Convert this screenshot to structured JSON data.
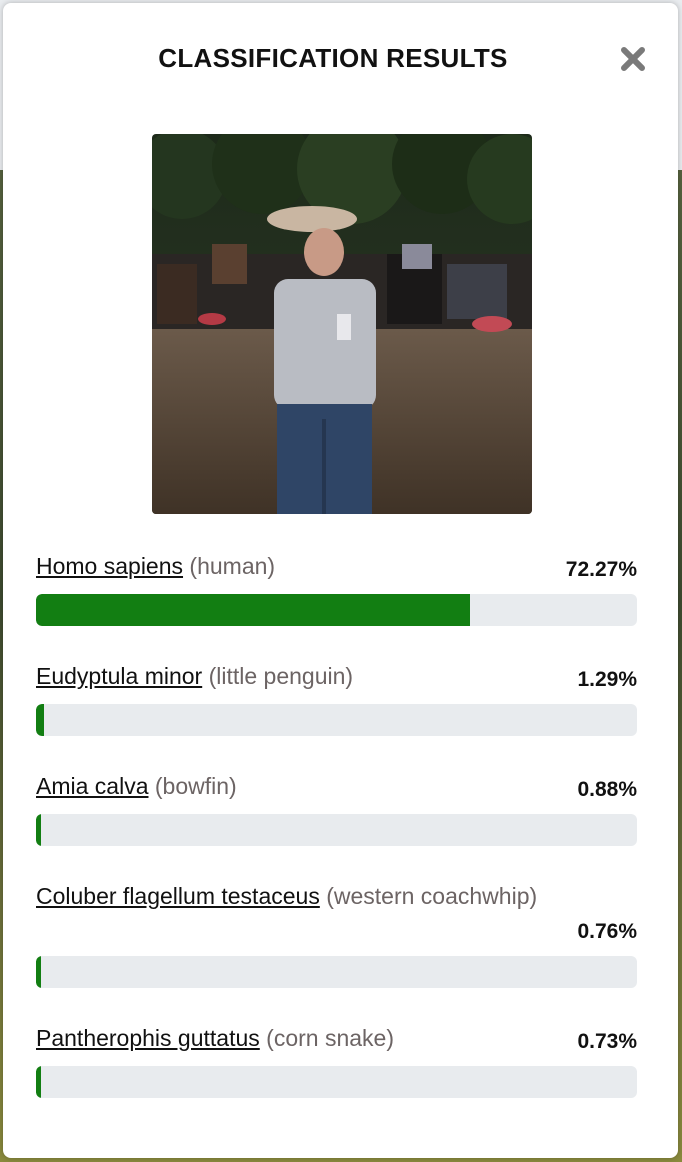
{
  "modal": {
    "title": "CLASSIFICATION RESULTS",
    "close_icon": "close-icon"
  },
  "results": [
    {
      "scientific": "Homo sapiens",
      "common": "(human)",
      "percent_label": "72.27%",
      "percent": 72.27
    },
    {
      "scientific": "Eudyptula minor",
      "common": "(little penguin)",
      "percent_label": "1.29%",
      "percent": 1.29
    },
    {
      "scientific": "Amia calva",
      "common": "(bowfin)",
      "percent_label": "0.88%",
      "percent": 0.88
    },
    {
      "scientific": "Coluber flagellum testaceus",
      "common": "(western coachwhip)",
      "percent_label": "0.76%",
      "percent": 0.76
    },
    {
      "scientific": "Pantherophis guttatus",
      "common": "(corn snake)",
      "percent_label": "0.73%",
      "percent": 0.73
    }
  ],
  "colors": {
    "bar_fill": "#127e12",
    "bar_track": "#e8ebee",
    "common_name": "#6c6464"
  }
}
